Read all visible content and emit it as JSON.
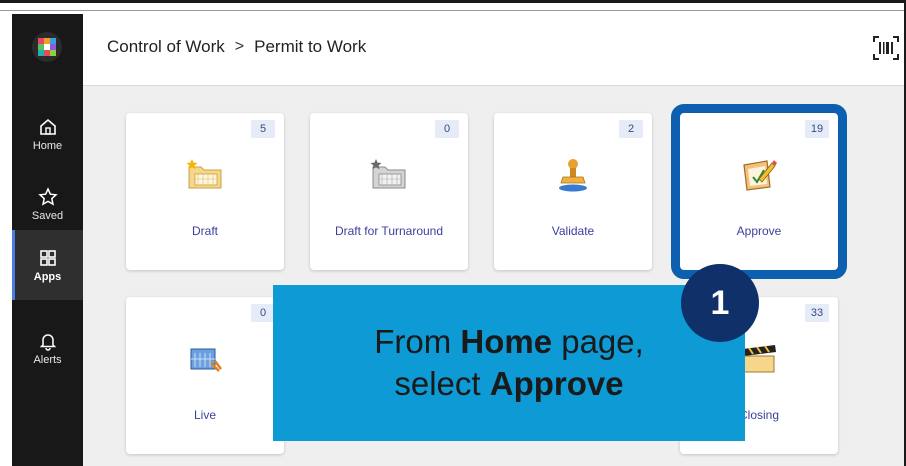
{
  "header": {
    "breadcrumb": [
      "Control of Work",
      "Permit to Work"
    ],
    "separator": ">"
  },
  "sidebar": {
    "items": [
      {
        "label": "Home",
        "icon": "home-icon"
      },
      {
        "label": "Saved",
        "icon": "star-icon"
      },
      {
        "label": "Apps",
        "icon": "apps-grid-icon",
        "active": true
      },
      {
        "label": "Alerts",
        "icon": "bell-icon"
      }
    ]
  },
  "tiles": [
    {
      "label": "Draft",
      "count": "5",
      "icon": "draft-folder-star-icon"
    },
    {
      "label": "Draft for Turnaround",
      "count": "0",
      "icon": "draft-folder-gray-icon"
    },
    {
      "label": "Validate",
      "count": "2",
      "icon": "stamp-icon"
    },
    {
      "label": "Approve",
      "count": "19",
      "icon": "approve-pencil-icon",
      "selected": true
    },
    {
      "label": "Live",
      "count": "0",
      "icon": "live-calendar-icon"
    },
    {
      "label": "Closing",
      "count": "33",
      "icon": "clapperboard-icon"
    }
  ],
  "callout": {
    "step_number": "1",
    "line1": {
      "pre": "From ",
      "bold": "Home",
      "post": " page,"
    },
    "line2": {
      "pre": "select ",
      "bold": "Approve"
    }
  },
  "colors": {
    "sidebar_bg": "#181818",
    "selection_outline": "#0d5fb0",
    "callout_bg": "#0d9ad5",
    "step_circle": "#10306a",
    "badge_bg": "#e6ebf8",
    "tile_label": "#3b3f9c"
  }
}
